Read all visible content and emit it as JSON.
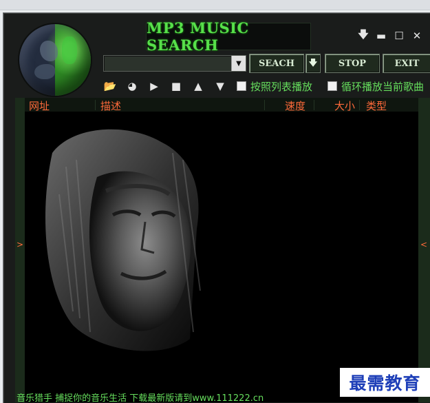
{
  "app": {
    "title": "MP3 MUSIC SEARCH",
    "window_controls": {
      "download": "🡇",
      "minimize": "▬",
      "maximize": "☐",
      "close": "✕"
    }
  },
  "search": {
    "value": ""
  },
  "buttons": {
    "search": "SEACH",
    "search_dropdown": "🡇",
    "stop": "STOP",
    "exit": "EXIT"
  },
  "toolbar": {
    "icons": [
      "open-folder-icon",
      "globe-icon",
      "play-icon",
      "stop-icon",
      "up-icon",
      "down-icon"
    ],
    "glyphs": {
      "open": "📂",
      "globe": "◕",
      "play": "▶",
      "stop": "■",
      "up": "▲",
      "down": "▼"
    },
    "options": [
      {
        "label": "按照列表播放",
        "checked": false
      },
      {
        "label": "循环播放当前歌曲",
        "checked": false
      }
    ]
  },
  "table": {
    "columns": [
      "网址",
      "描述",
      "速度",
      "大小",
      "类型"
    ],
    "left_arrow": ">",
    "right_arrow": "<"
  },
  "status": {
    "text": "音乐猎手 捕捉你的音乐生活 下载最新版请到www.111222.cn"
  },
  "watermark": "最需教育",
  "colors": {
    "accent_green": "#66de5d",
    "header_orange": "#ff6a3a",
    "frame": "#1a1c1b"
  }
}
